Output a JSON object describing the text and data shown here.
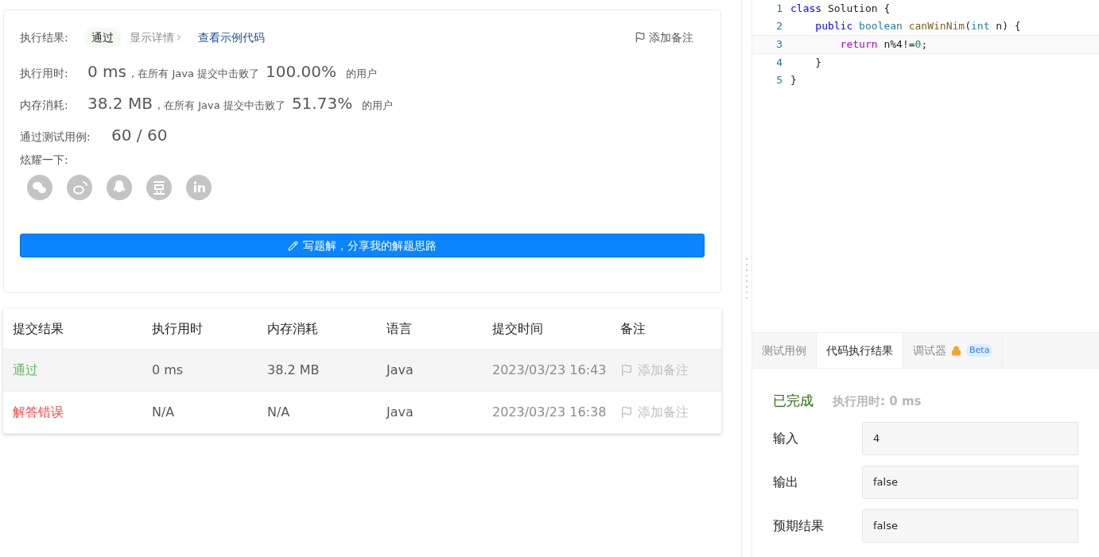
{
  "result": {
    "label": "执行结果:",
    "status": "通过",
    "details_link": "显示详情",
    "sample_link": "查看示例代码",
    "note_button": "添加备注"
  },
  "stats": [
    {
      "label": "执行用时:",
      "value": "0 ms",
      "middle": ", 在所有 Java 提交中击败了",
      "percent": "100.00%",
      "suffix": "的用户"
    },
    {
      "label": "内存消耗:",
      "value": "38.2 MB",
      "middle": ", 在所有 Java 提交中击败了",
      "percent": "51.73%",
      "suffix": "的用户"
    }
  ],
  "tests": {
    "label": "通过测试用例:",
    "value": "60 / 60"
  },
  "share": {
    "label": "炫耀一下:",
    "icons": [
      {
        "kind": "wechat"
      },
      {
        "kind": "weibo"
      },
      {
        "kind": "qq"
      },
      {
        "kind": "douban"
      },
      {
        "kind": "linkedin"
      }
    ]
  },
  "write_button": "写题解，分享我的解题思路",
  "table": {
    "columns": [
      "提交结果",
      "执行用时",
      "内存消耗",
      "语言",
      "提交时间",
      "备注"
    ],
    "rows": [
      {
        "status": "通过",
        "kind": "pass",
        "time": "0 ms",
        "memory": "38.2 MB",
        "language": "Java",
        "submitted": "2023/03/23 16:43",
        "note": "添加备注"
      },
      {
        "status": "解答错误",
        "kind": "fail",
        "time": "N/A",
        "memory": "N/A",
        "language": "Java",
        "submitted": "2023/03/23 16:38",
        "note": "添加备注"
      }
    ]
  },
  "editor": {
    "lines": [
      {
        "number": "1",
        "tokens": [
          {
            "kind": "keyword",
            "text": "class "
          },
          {
            "kind": "plain",
            "text": "Solution {"
          }
        ]
      },
      {
        "number": "2",
        "tokens": [
          {
            "kind": "keyword",
            "text": "    public "
          },
          {
            "kind": "type",
            "text": "boolean "
          },
          {
            "kind": "name",
            "text": "canWinNim"
          },
          {
            "kind": "plain",
            "text": "("
          },
          {
            "kind": "type",
            "text": "int "
          },
          {
            "kind": "plain",
            "text": "n) {"
          }
        ]
      },
      {
        "number": "3",
        "tokens": [
          {
            "kind": "control",
            "text": "        return "
          },
          {
            "kind": "plain",
            "text": "n%4!="
          },
          {
            "kind": "number",
            "text": "0"
          },
          {
            "kind": "plain",
            "text": ";"
          }
        ]
      },
      {
        "number": "4",
        "tokens": [
          {
            "kind": "plain",
            "text": "    }"
          }
        ]
      },
      {
        "number": "5",
        "tokens": [
          {
            "kind": "plain",
            "text": "}"
          }
        ]
      }
    ]
  },
  "bottom_tabs": [
    {
      "label": "测试用例",
      "selected": false
    },
    {
      "label": "代码执行结果",
      "selected": true
    },
    {
      "label": "调试器",
      "selected": false,
      "badge": "Beta",
      "locked": true
    }
  ],
  "run_result": {
    "status": "已完成",
    "time": "执行用时: 0 ms",
    "fields": [
      {
        "label": "输入",
        "value": "4"
      },
      {
        "label": "输出",
        "value": "false"
      },
      {
        "label": "预期结果",
        "value": "false"
      }
    ]
  }
}
